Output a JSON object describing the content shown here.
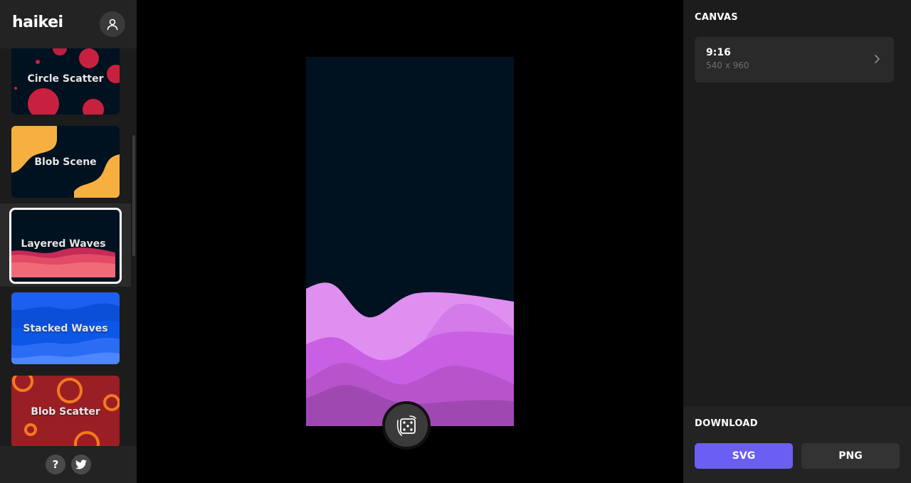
{
  "app": {
    "logo": "haikei"
  },
  "sidebar": {
    "generators": [
      {
        "label": "Circle Scatter"
      },
      {
        "label": "Blob Scene"
      },
      {
        "label": "Layered Waves",
        "selected": true
      },
      {
        "label": "Stacked Waves"
      },
      {
        "label": "Blob Scatter"
      }
    ],
    "footer": {
      "help_label": "?"
    }
  },
  "canvas_panel": {
    "title": "CANVAS",
    "option": {
      "ratio": "9:16",
      "dimensions": "540 x 960"
    }
  },
  "download": {
    "title": "DOWNLOAD",
    "svg_label": "SVG",
    "png_label": "PNG"
  },
  "colors": {
    "accent": "#6b5ef2",
    "canvas_bg": "#001220",
    "wave_colors": [
      "#df8ff0",
      "#d57ae9",
      "#c95fe3",
      "#b754cb",
      "#9f48b2"
    ]
  }
}
